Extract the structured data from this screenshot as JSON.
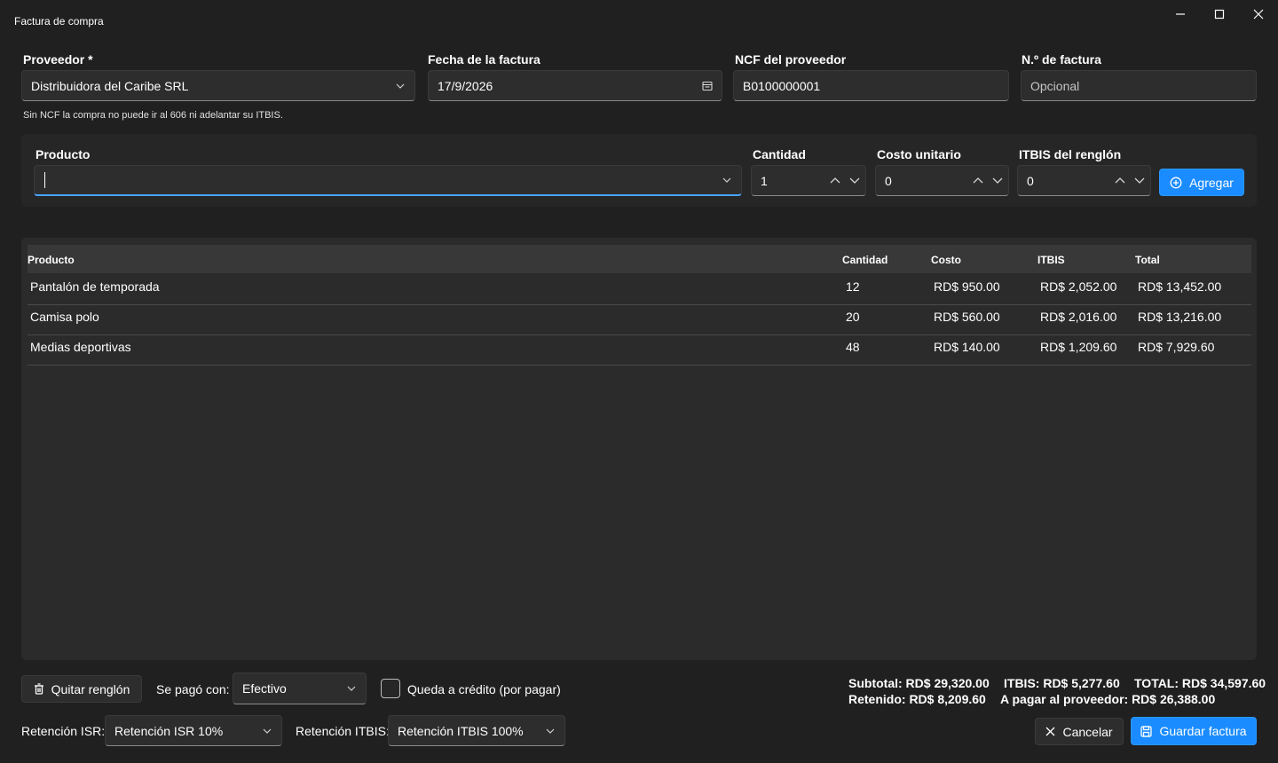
{
  "window": {
    "title": "Factura de compra",
    "controls": [
      "minimize-icon",
      "maximize-icon",
      "close-icon"
    ]
  },
  "header": {
    "supplier": {
      "label": "Proveedor *",
      "value": "Distribuidora del Caribe SRL"
    },
    "invoice_date": {
      "label": "Fecha de la factura",
      "value": "17/9/2026"
    },
    "supplier_ncf": {
      "label": "NCF del proveedor",
      "value": "B0100000001"
    },
    "invoice_number": {
      "label": "N.º de factura",
      "placeholder": "Opcional"
    },
    "hint": "Sin NCF la compra no puede ir al 606 ni adelantar su ITBIS."
  },
  "entry": {
    "product": {
      "label": "Producto",
      "value": ""
    },
    "quantity": {
      "label": "Cantidad",
      "value": "1"
    },
    "unit_cost": {
      "label": "Costo unitario",
      "value": "0"
    },
    "line_itbis": {
      "label": "ITBIS del renglón",
      "value": "0"
    },
    "add_label": "Agregar"
  },
  "table": {
    "columns": [
      "Producto",
      "Cantidad",
      "Costo",
      "ITBIS",
      "Total"
    ],
    "rows": [
      {
        "product": "Pantalón de temporada",
        "qty": "12",
        "cost": "RD$ 950.00",
        "itbis": "RD$ 2,052.00",
        "total": "RD$ 13,452.00"
      },
      {
        "product": "Camisa polo",
        "qty": "20",
        "cost": "RD$ 560.00",
        "itbis": "RD$ 2,016.00",
        "total": "RD$ 13,216.00"
      },
      {
        "product": "Medias deportivas",
        "qty": "48",
        "cost": "RD$ 140.00",
        "itbis": "RD$ 1,209.60",
        "total": "RD$ 7,929.60"
      }
    ]
  },
  "footer": {
    "remove_row_label": "Quitar renglón",
    "paid_with_label": "Se pagó con:",
    "paid_with_value": "Efectivo",
    "credit_label": "Queda a crédito (por pagar)",
    "credit_checked": false,
    "isr_label": "Retención ISR:",
    "isr_value": "Retención ISR 10%",
    "itbis_ret_label": "Retención ITBIS:",
    "itbis_ret_value": "Retención ITBIS 100%",
    "subtotal": "Subtotal: RD$ 29,320.00",
    "itbis_total": "ITBIS: RD$ 5,277.60",
    "grand_total": "TOTAL: RD$ 34,597.60",
    "withheld": "Retenido: RD$ 8,209.60",
    "to_pay": "A pagar al proveedor: RD$ 26,388.00",
    "cancel_label": "Cancelar",
    "save_label": "Guardar factura"
  },
  "colors": {
    "background": "#202020",
    "accent": "#1a8cff",
    "field": "#2d2d2d",
    "table_header": "#383838"
  }
}
